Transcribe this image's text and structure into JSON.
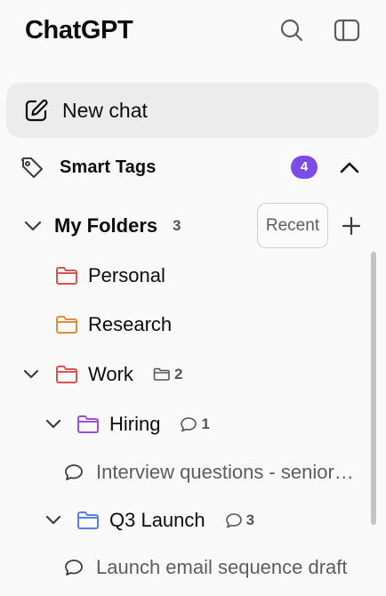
{
  "header": {
    "title": "ChatGPT",
    "search_icon": "search-icon",
    "sidebar_toggle_icon": "sidebar-toggle-icon"
  },
  "new_chat": {
    "label": "New chat",
    "icon": "edit-icon"
  },
  "smart_tags": {
    "label": "Smart Tags",
    "count": "4",
    "icon": "tag-icon"
  },
  "folders": {
    "label": "My Folders",
    "count": "3",
    "recent_label": "Recent",
    "items": [
      {
        "label": "Personal",
        "color": "#d9534f"
      },
      {
        "label": "Research",
        "color": "#e38c3c"
      },
      {
        "label": "Work",
        "color": "#d9534f",
        "subfolder_count": "2"
      }
    ],
    "subfolders": [
      {
        "label": "Hiring",
        "color": "#9b4fd1",
        "chat_count": "1",
        "chat_title": "Interview questions - senior engineer"
      },
      {
        "label": "Q3 Launch",
        "color": "#5b7fe6",
        "chat_count": "3",
        "chat_title": "Launch email sequence draft"
      }
    ]
  },
  "colors": {
    "accent": "#7d4ce8",
    "background": "#f9f9f9",
    "hover": "#ececec"
  }
}
